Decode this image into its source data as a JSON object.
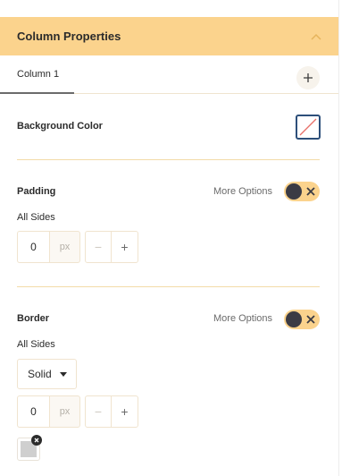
{
  "header": {
    "title": "Column Properties",
    "collapse_icon": "chevron-up-icon"
  },
  "tabs": {
    "items": [
      {
        "label": "Column 1",
        "active": true
      }
    ],
    "add_icon": "plus-icon"
  },
  "background": {
    "label": "Background Color",
    "swatch": "none"
  },
  "padding": {
    "label": "Padding",
    "more_options": "More Options",
    "toggle_on": false,
    "all_sides_label": "All Sides",
    "value": "0",
    "unit": "px",
    "minus": "−",
    "plus": "+"
  },
  "border": {
    "label": "Border",
    "more_options": "More Options",
    "toggle_on": false,
    "all_sides_label": "All Sides",
    "style_value": "Solid",
    "value": "0",
    "unit": "px",
    "minus": "−",
    "plus": "+",
    "color": "#cfcfcf"
  },
  "colors": {
    "accent": "#fbd38d",
    "divider": "#f3dba8",
    "swatch_border": "#2d4f7a"
  }
}
